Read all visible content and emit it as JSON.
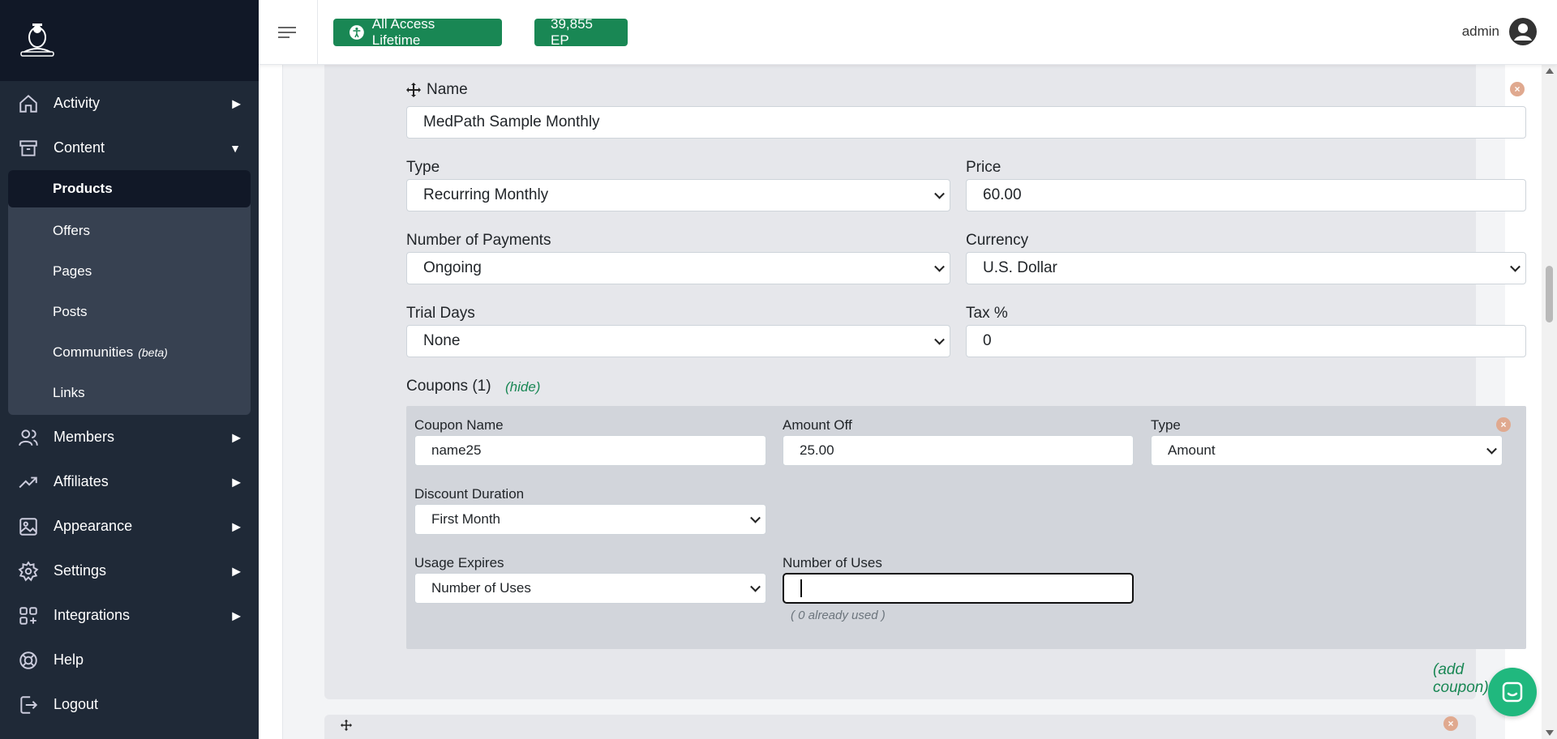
{
  "topbar": {
    "plan_badge": "All Access Lifetime",
    "ep_badge": "39,855 EP",
    "user": "admin"
  },
  "sidebar": {
    "items": [
      {
        "label": "Activity",
        "icon": "home-icon"
      },
      {
        "label": "Content",
        "icon": "archive-icon"
      },
      {
        "label": "Members",
        "icon": "users-icon"
      },
      {
        "label": "Affiliates",
        "icon": "trending-icon"
      },
      {
        "label": "Appearance",
        "icon": "image-icon"
      },
      {
        "label": "Settings",
        "icon": "gear-icon"
      },
      {
        "label": "Integrations",
        "icon": "apps-add-icon"
      },
      {
        "label": "Help",
        "icon": "lifebuoy-icon"
      },
      {
        "label": "Logout",
        "icon": "logout-icon"
      }
    ],
    "content_sub": [
      {
        "label": "Products"
      },
      {
        "label": "Offers"
      },
      {
        "label": "Pages"
      },
      {
        "label": "Posts"
      },
      {
        "label": "Communities",
        "badge": "(beta)"
      },
      {
        "label": "Links"
      }
    ]
  },
  "form": {
    "name_label": "Name",
    "name_value": "MedPath Sample Monthly",
    "type_label": "Type",
    "type_value": "Recurring Monthly",
    "price_label": "Price",
    "price_value": "60.00",
    "payments_label": "Number of Payments",
    "payments_value": "Ongoing",
    "currency_label": "Currency",
    "currency_value": "U.S. Dollar",
    "trial_label": "Trial Days",
    "trial_value": "None",
    "tax_label": "Tax %",
    "tax_value": "0",
    "coupons_label": "Coupons (1)",
    "hide_link": "(hide)",
    "add_coupon": "(add coupon)"
  },
  "coupon": {
    "name_label": "Coupon Name",
    "name_value": "name25",
    "amount_label": "Amount Off",
    "amount_value": "25.00",
    "type_label": "Type",
    "type_value": "Amount",
    "duration_label": "Discount Duration",
    "duration_value": "First Month",
    "expires_label": "Usage Expires",
    "expires_value": "Number of Uses",
    "uses_label": "Number of Uses",
    "uses_value": "",
    "uses_note": "( 0 already used )"
  }
}
